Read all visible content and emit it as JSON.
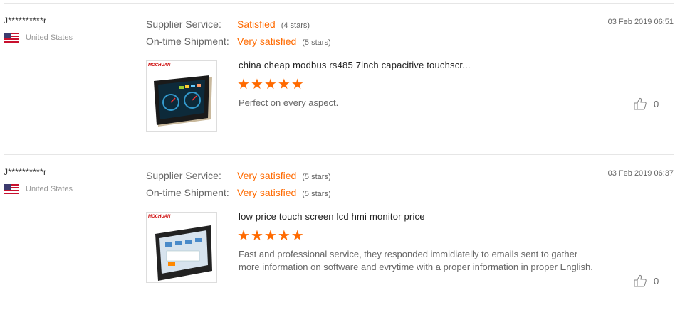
{
  "labels": {
    "supplier_service": "Supplier Service:",
    "ontime_shipment": "On-time Shipment:"
  },
  "reviews": [
    {
      "user": "J**********r",
      "country": "United States",
      "date": "03 Feb 2019 06:51",
      "supplier_service": "Satisfied",
      "supplier_stars": "(4 stars)",
      "ontime_shipment": "Very satisfied",
      "ontime_stars": "(5 stars)",
      "brand": "MOCHUAN",
      "product_title": "china cheap modbus rs485 7inch capacitive touchscr...",
      "rating": 5,
      "comment": "Perfect on every aspect.",
      "likes": "0"
    },
    {
      "user": "J**********r",
      "country": "United States",
      "date": "03 Feb 2019 06:37",
      "supplier_service": "Very satisfied",
      "supplier_stars": "(5 stars)",
      "ontime_shipment": "Very satisfied",
      "ontime_stars": "(5 stars)",
      "brand": "MOCHUAN",
      "product_title": "low price touch screen lcd hmi monitor price",
      "rating": 5,
      "comment": "Fast and professional service, they responded immidiatelly to emails sent to gather more information on software and evrytime with a proper information in proper English.",
      "likes": "0"
    }
  ],
  "colors": {
    "accent": "#ff6a00",
    "divider": "#e6e6e6",
    "muted": "#999999"
  },
  "icons": {
    "flag": "us-flag-icon",
    "like": "thumbs-up-icon",
    "star": "star-icon"
  }
}
